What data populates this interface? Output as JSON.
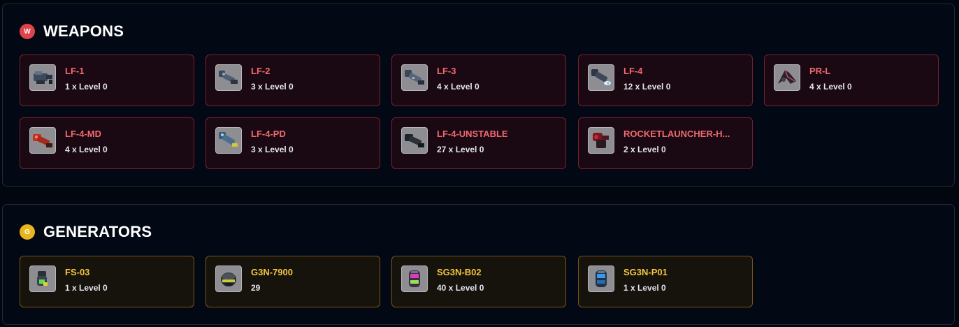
{
  "weapons": {
    "badge": "W",
    "title": "WEAPONS",
    "accent": "#f06a6f",
    "items": [
      {
        "name": "LF-1",
        "qty": "1 x Level 0",
        "icon": "laser-cannon-icon"
      },
      {
        "name": "LF-2",
        "qty": "3 x Level 0",
        "icon": "laser-cannon-icon"
      },
      {
        "name": "LF-3",
        "qty": "4 x Level 0",
        "icon": "laser-cannon-icon"
      },
      {
        "name": "LF-4",
        "qty": "12 x Level 0",
        "icon": "laser-cannon-icon"
      },
      {
        "name": "PR-L",
        "qty": "4 x Level 0",
        "icon": "prometheus-laser-icon"
      },
      {
        "name": "LF-4-MD",
        "qty": "4 x Level 0",
        "icon": "laser-cannon-icon"
      },
      {
        "name": "LF-4-PD",
        "qty": "3 x Level 0",
        "icon": "laser-cannon-icon"
      },
      {
        "name": "LF-4-UNSTABLE",
        "qty": "27 x Level 0",
        "icon": "laser-cannon-icon"
      },
      {
        "name": "ROCKETLAUNCHER-H...",
        "qty": "2 x Level 0",
        "icon": "rocket-launcher-icon"
      }
    ]
  },
  "generators": {
    "badge": "G",
    "title": "GENERATORS",
    "accent": "#f3c53d",
    "items": [
      {
        "name": "FS-03",
        "qty": "1 x Level 0",
        "icon": "shield-generator-icon"
      },
      {
        "name": "G3N-7900",
        "qty": "29",
        "icon": "speed-generator-icon"
      },
      {
        "name": "SG3N-B02",
        "qty": "40 x Level 0",
        "icon": "shield-generator-icon"
      },
      {
        "name": "SG3N-P01",
        "qty": "1 x Level 0",
        "icon": "shield-generator-icon"
      }
    ]
  }
}
